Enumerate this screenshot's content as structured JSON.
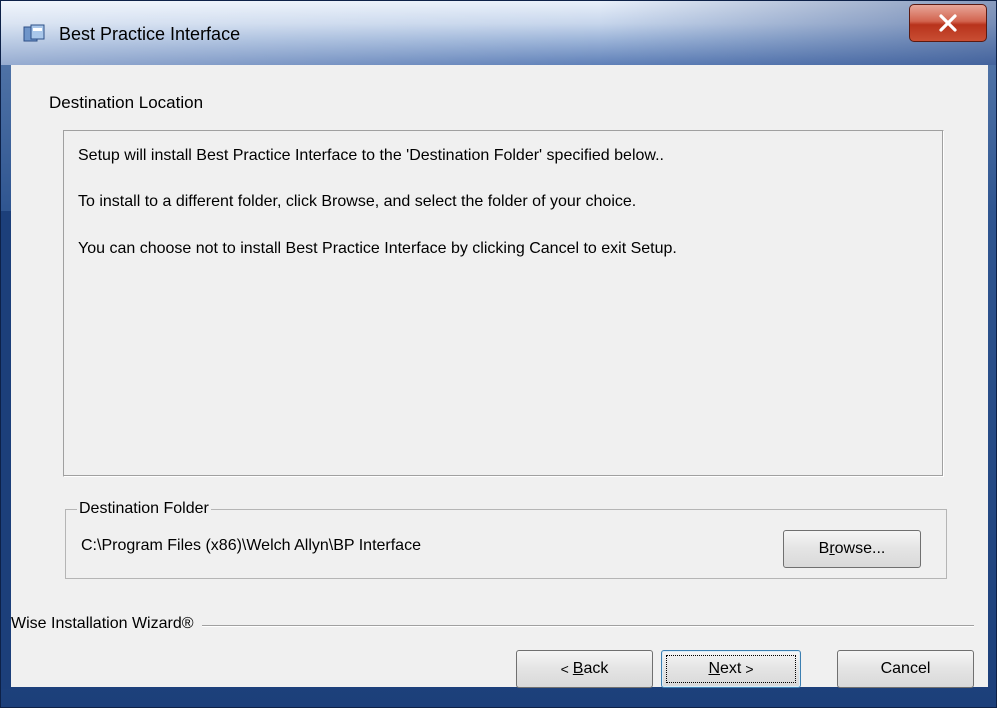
{
  "window": {
    "title": "Best Practice Interface",
    "close_symbol": "X",
    "icon": "installer-app-icon"
  },
  "page": {
    "heading": "Destination Location",
    "info_lines": [
      "Setup will install Best Practice Interface  to the 'Destination Folder' specified below..",
      "To install to a different folder, click Browse, and select the folder of your choice.",
      "You can choose not to install Best Practice Interface by clicking Cancel to exit Setup."
    ]
  },
  "destination": {
    "group_label": "Destination Folder",
    "path": "C:\\Program Files (x86)\\Welch Allyn\\BP Interface",
    "browse_label_prefix": "B",
    "browse_label_accel": "r",
    "browse_label_rest": "owse..."
  },
  "footer": {
    "brand": "Wise Installation Wizard®",
    "back_arrow": "<",
    "back_accel": "B",
    "back_rest": "ack",
    "next_accel": "N",
    "next_rest": "ext",
    "next_arrow": ">",
    "cancel_label": "Cancel"
  },
  "colors": {
    "titlebar_accent": "#5f80b8",
    "close_button": "#c94e33",
    "dialog_bg": "#f0f0f0",
    "default_button_border": "#3c7fb1"
  }
}
